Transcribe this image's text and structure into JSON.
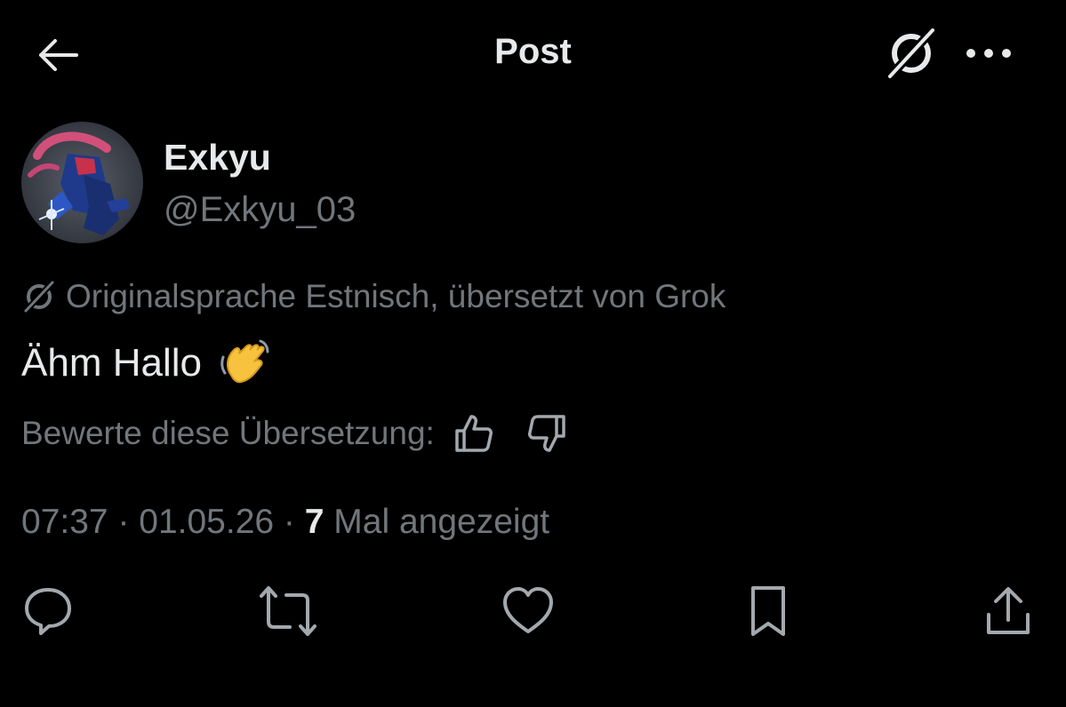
{
  "header": {
    "title": "Post",
    "back_icon": "arrow-left-icon",
    "grok_icon": "grok-icon",
    "more_icon": "more-horizontal-icon"
  },
  "author": {
    "display_name": "Exkyu",
    "handle": "@Exkyu_03",
    "avatar_icon": "avatar-image"
  },
  "translation": {
    "note": "Originalsprache Estnisch, übersetzt von Grok",
    "icon": "grok-icon"
  },
  "tweet": {
    "text": "Ähm Hallo",
    "emoji": "waving-hand-emoji"
  },
  "rating": {
    "label": "Bewerte diese Übersetzung:",
    "up_icon": "thumbs-up-icon",
    "down_icon": "thumbs-down-icon"
  },
  "meta": {
    "time": "07:37",
    "separator": " · ",
    "date": "01.05.26",
    "views_count": "7",
    "views_label": " Mal angezeigt"
  },
  "actions": [
    {
      "name": "reply",
      "icon": "reply-icon"
    },
    {
      "name": "repost",
      "icon": "repost-icon"
    },
    {
      "name": "like",
      "icon": "heart-icon"
    },
    {
      "name": "bookmark",
      "icon": "bookmark-icon"
    },
    {
      "name": "share",
      "icon": "share-icon"
    }
  ],
  "colors": {
    "background": "#000000",
    "text_primary": "#e7e9ea",
    "text_secondary": "#71767b"
  }
}
